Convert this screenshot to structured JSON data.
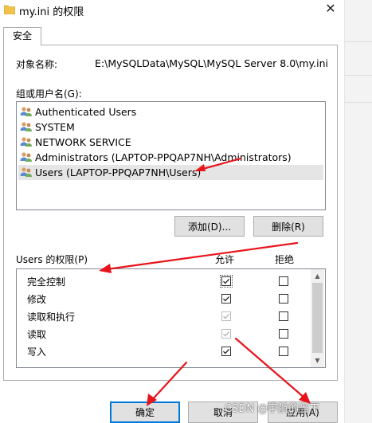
{
  "window": {
    "title": "my.ini 的权限"
  },
  "tabs": [
    {
      "label": "安全"
    }
  ],
  "object": {
    "label": "对象名称:",
    "value": "E:\\MySQLData\\MySQL\\MySQL Server 8.0\\my.ini"
  },
  "groups": {
    "label": "组或用户名(G):",
    "items": [
      {
        "label": "Authenticated Users",
        "selected": false
      },
      {
        "label": "SYSTEM",
        "selected": false
      },
      {
        "label": "NETWORK SERVICE",
        "selected": false
      },
      {
        "label": "Administrators (LAPTOP-PPQAP7NH\\Administrators)",
        "selected": false
      },
      {
        "label": "Users (LAPTOP-PPQAP7NH\\Users)",
        "selected": true
      }
    ]
  },
  "buttons": {
    "add": "添加(D)...",
    "remove": "删除(R)",
    "ok": "确定",
    "cancel": "取消",
    "apply": "应用(A)"
  },
  "permissions": {
    "label": "Users 的权限(P)",
    "allow_header": "允许",
    "deny_header": "拒绝",
    "rows": [
      {
        "name": "完全控制",
        "allow": true,
        "allow_inherited": false,
        "deny": false
      },
      {
        "name": "修改",
        "allow": true,
        "allow_inherited": false,
        "deny": false
      },
      {
        "name": "读取和执行",
        "allow": true,
        "allow_inherited": true,
        "deny": false
      },
      {
        "name": "读取",
        "allow": true,
        "allow_inherited": true,
        "deny": false
      },
      {
        "name": "写入",
        "allow": true,
        "allow_inherited": false,
        "deny": false
      }
    ]
  },
  "watermark": "CSDN @宇航的当下",
  "colors": {
    "annotation": "#e8141b",
    "selection": "#e5e5e5",
    "default_button_border": "#0078d7"
  },
  "icons": {
    "title": "folder-icon",
    "user": "users-group-icon",
    "close": "close-icon"
  }
}
